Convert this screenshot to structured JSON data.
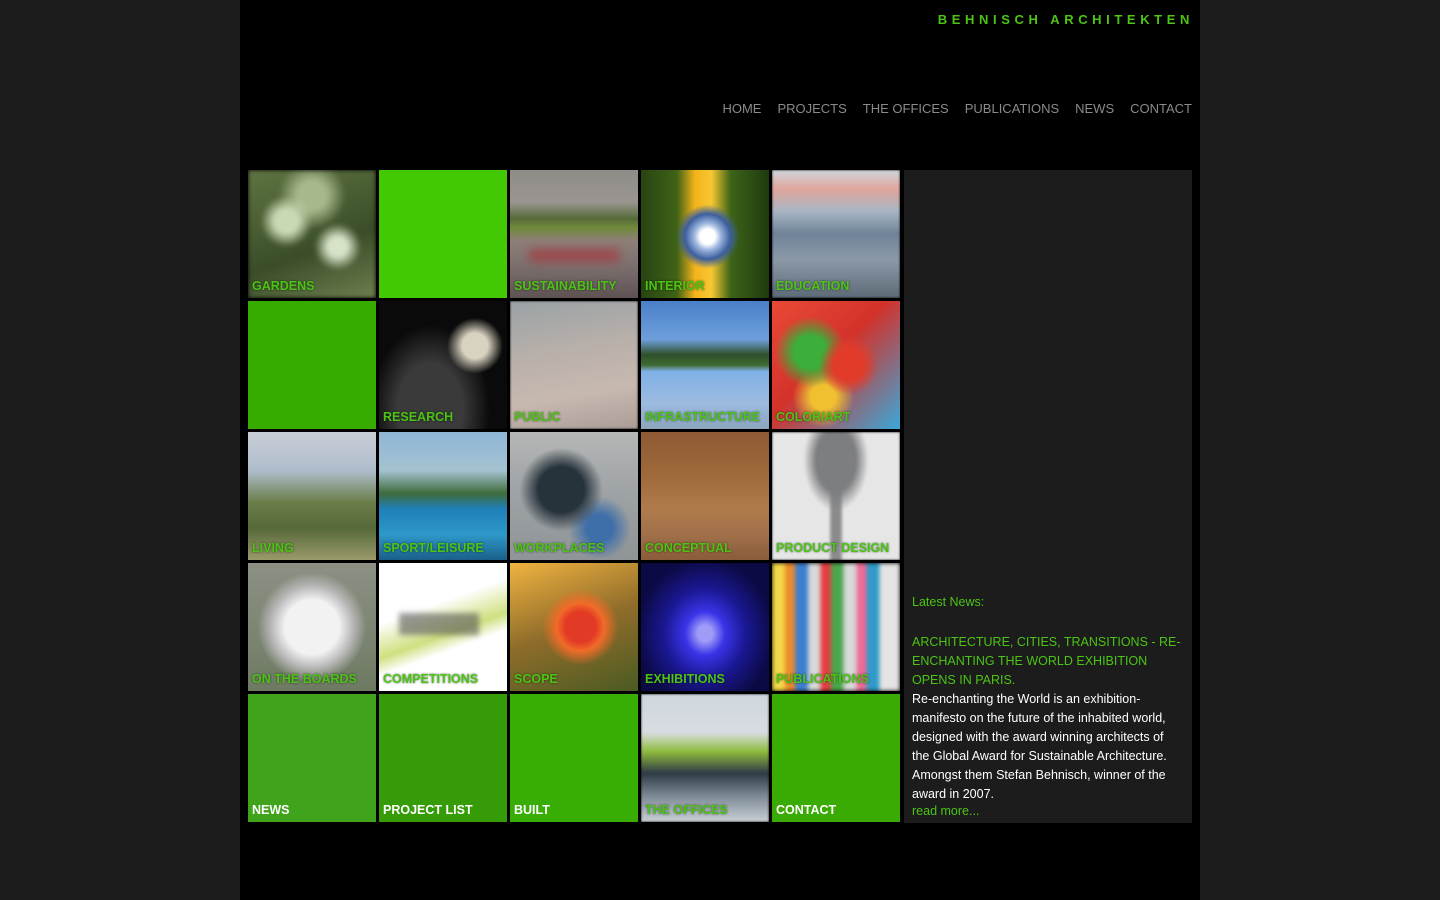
{
  "brand": "BEHNISCH ARCHITEKTEN",
  "nav": [
    "HOME",
    "PROJECTS",
    "THE OFFICES",
    "PUBLICATIONS",
    "NEWS",
    "CONTACT"
  ],
  "colors": {
    "accent": "#4cc414",
    "page_bg": "#000000",
    "outer_bg": "#1c1c1c",
    "nav_text": "#8a8a8a"
  },
  "tiles": [
    {
      "label": "GARDENS",
      "kind": "photo"
    },
    {
      "label": "",
      "kind": "solid",
      "color": "#42c904"
    },
    {
      "label": "SUSTAINABILITY",
      "kind": "photo"
    },
    {
      "label": "INTERIOR",
      "kind": "photo"
    },
    {
      "label": "EDUCATION",
      "kind": "photo"
    },
    {
      "label": "",
      "kind": "solid",
      "color": "#36ac01"
    },
    {
      "label": "RESEARCH",
      "kind": "photo"
    },
    {
      "label": "PUBLIC",
      "kind": "photo"
    },
    {
      "label": "INFRASTRUCTURE",
      "kind": "photo"
    },
    {
      "label": "COLOR/ART",
      "kind": "photo"
    },
    {
      "label": "LIVING",
      "kind": "photo"
    },
    {
      "label": "SPORT/LEISURE",
      "kind": "photo"
    },
    {
      "label": "WORKPLACES",
      "kind": "photo"
    },
    {
      "label": "CONCEPTUAL",
      "kind": "photo"
    },
    {
      "label": "PRODUCT DESIGN",
      "kind": "photo"
    },
    {
      "label": "ON THE BOARDS",
      "kind": "photo"
    },
    {
      "label": "COMPETITIONS",
      "kind": "photo"
    },
    {
      "label": "SCOPE",
      "kind": "photo"
    },
    {
      "label": "EXHIBITIONS",
      "kind": "photo"
    },
    {
      "label": "PUBLICATIONS",
      "kind": "photo"
    },
    {
      "label": "NEWS",
      "kind": "solid",
      "color": "#3fa41b"
    },
    {
      "label": "PROJECT LIST",
      "kind": "solid",
      "color": "#359b06"
    },
    {
      "label": "BUILT",
      "kind": "solid",
      "color": "#38ad05"
    },
    {
      "label": "THE OFFICES",
      "kind": "photo"
    },
    {
      "label": "CONTACT",
      "kind": "solid",
      "color": "#3aaa05"
    }
  ],
  "news": {
    "heading": "Latest News:",
    "title": "ARCHITECTURE, CITIES, TRANSITIONS - RE-ENCHANTING THE WORLD EXHIBITION OPENS IN PARIS.",
    "body": "Re-enchanting the World is an exhibition-manifesto on the future of the inhabited world, designed with the award winning architects of the Global Award for Sustainable Architecture. Amongst them Stefan Behnisch, winner of the award in 2007.",
    "read_more": "read more..."
  }
}
